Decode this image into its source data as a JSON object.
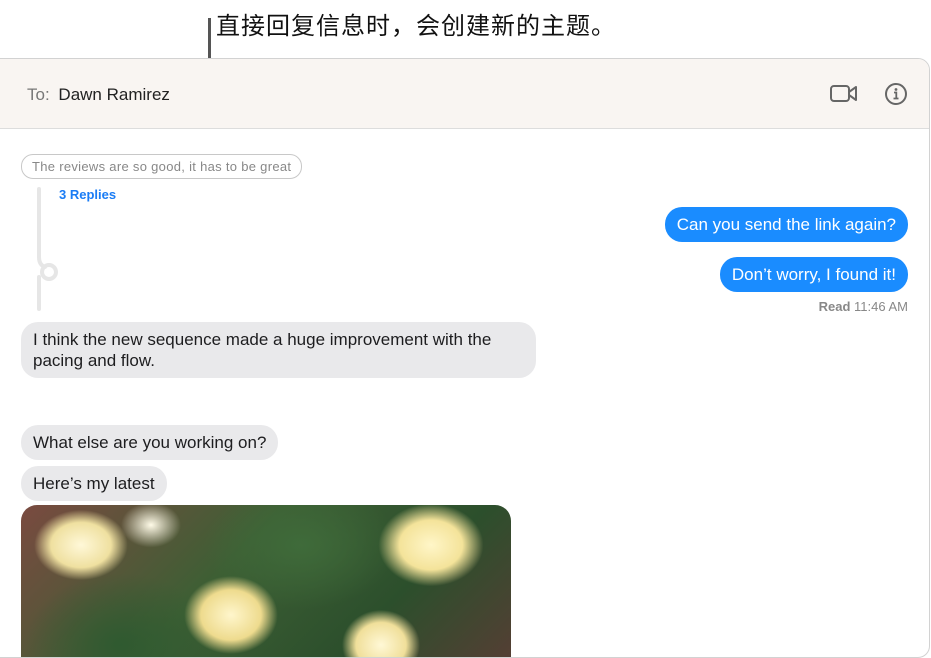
{
  "callout": "直接回复信息时，会创建新的主题。",
  "header": {
    "to_label": "To:",
    "recipient": "Dawn Ramirez",
    "icons": [
      "video-camera-icon",
      "info-icon"
    ]
  },
  "thread": {
    "origin": "The reviews are so good, it has to be great",
    "replies": "3 Replies"
  },
  "messages": [
    {
      "dir": "out",
      "text": "Can you send the link again?"
    },
    {
      "dir": "out",
      "text": "Don’t worry, I found it!"
    },
    {
      "dir": "in",
      "text": "I think the new sequence made a huge improvement with the pacing and flow."
    },
    {
      "dir": "in",
      "text": "What else are you working on?"
    },
    {
      "dir": "in",
      "text": "Here’s my latest"
    }
  ],
  "receipt": {
    "label": "Read",
    "time": "11:46 AM"
  },
  "colors": {
    "outgoing": "#1a8cff",
    "incoming": "#e9e9eb",
    "link": "#1a7cf5"
  }
}
